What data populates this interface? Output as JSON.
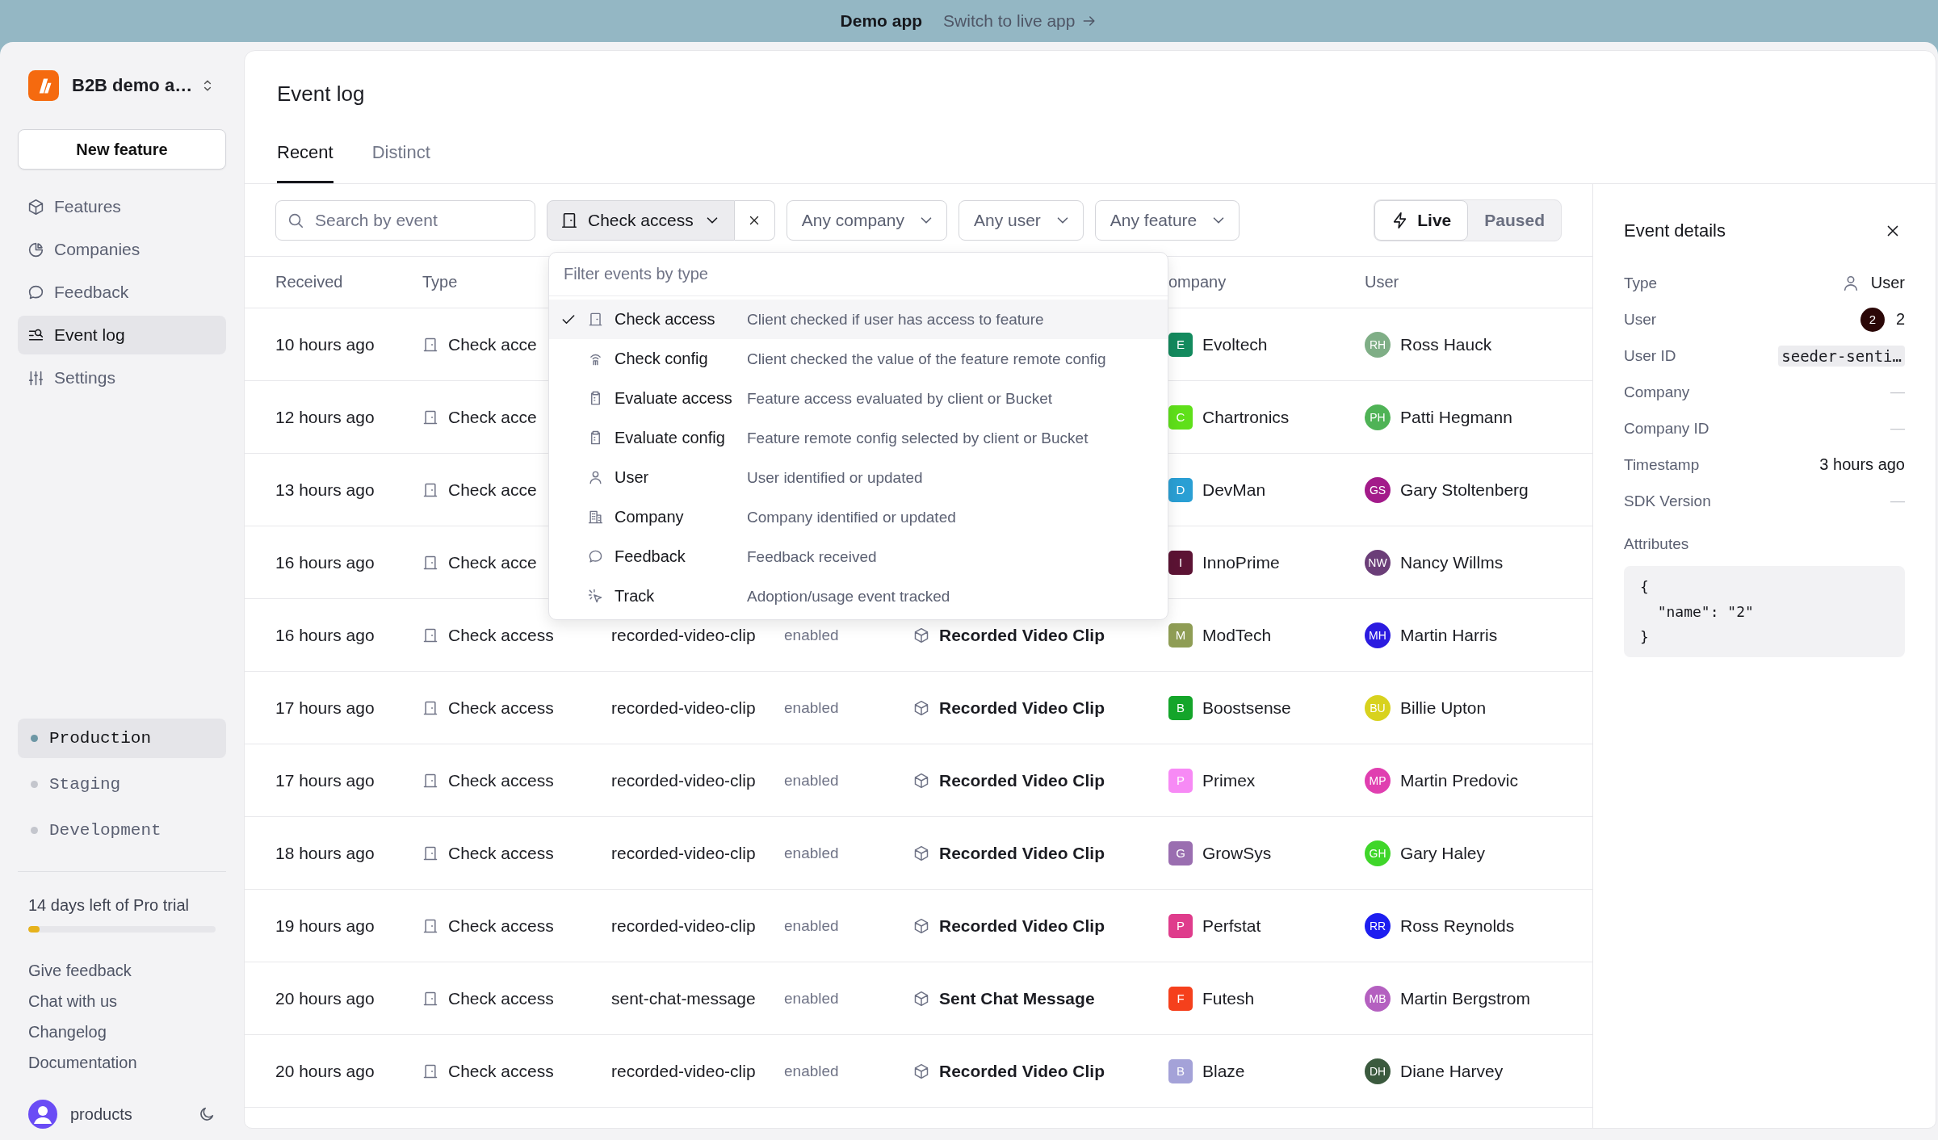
{
  "banner": {
    "label": "Demo app",
    "link": "Switch to live app"
  },
  "sidebar": {
    "workspace": "B2B demo a…",
    "new_feature": "New feature",
    "nav": [
      {
        "label": "Features",
        "kind": "features",
        "selected": false
      },
      {
        "label": "Companies",
        "kind": "companies",
        "selected": false
      },
      {
        "label": "Feedback",
        "kind": "feedback",
        "selected": false
      },
      {
        "label": "Event log",
        "kind": "events",
        "selected": true
      },
      {
        "label": "Settings",
        "kind": "settings",
        "selected": false
      }
    ],
    "environments": [
      {
        "label": "Production",
        "selected": true
      },
      {
        "label": "Staging",
        "selected": false
      },
      {
        "label": "Development",
        "selected": false
      }
    ],
    "trial": {
      "text": "14 days left of Pro trial",
      "level": 0.06
    },
    "links": [
      "Give feedback",
      "Chat with us",
      "Changelog",
      "Documentation"
    ],
    "account": {
      "name": "products"
    }
  },
  "main": {
    "title": "Event log",
    "tabs": [
      {
        "label": "Recent",
        "selected": true
      },
      {
        "label": "Distinct",
        "selected": false
      }
    ],
    "search": {
      "placeholder": "Search by event"
    },
    "type_filter": {
      "value": "Check access"
    },
    "filters": [
      "Any company",
      "Any user",
      "Any feature"
    ],
    "mode": [
      {
        "label": "Live",
        "selected": true
      },
      {
        "label": "Paused",
        "selected": false
      }
    ],
    "columns": [
      "Received",
      "Type",
      "ompany",
      "User"
    ],
    "rows": [
      {
        "received": "10 hours ago",
        "type": "Check acce",
        "company": {
          "initial": "E",
          "name": "Evoltech",
          "color": "#138a5e"
        },
        "user": {
          "initials": "RH",
          "name": "Ross Hauck",
          "color": "#7fae86"
        }
      },
      {
        "received": "12 hours ago",
        "type": "Check acce",
        "company": {
          "initial": "C",
          "name": "Chartronics",
          "color": "#5fe01a"
        },
        "user": {
          "initials": "PH",
          "name": "Patti Hegmann",
          "color": "#4fb356"
        }
      },
      {
        "received": "13 hours ago",
        "type": "Check acce",
        "company": {
          "initial": "D",
          "name": "DevMan",
          "color": "#2a9fd4"
        },
        "user": {
          "initials": "GS",
          "name": "Gary Stoltenberg",
          "color": "#a31b8a"
        }
      },
      {
        "received": "16 hours ago",
        "type": "Check acce",
        "company": {
          "initial": "I",
          "name": "InnoPrime",
          "color": "#5c1334"
        },
        "user": {
          "initials": "NW",
          "name": "Nancy Willms",
          "color": "#6b3e78"
        }
      },
      {
        "received": "16 hours ago",
        "type": "Check access",
        "key": "recorded-video-clip",
        "status": "enabled",
        "feature": "Recorded Video Clip",
        "company": {
          "initial": "M",
          "name": "ModTech",
          "color": "#8f9d55"
        },
        "user": {
          "initials": "MH",
          "name": "Martin Harris",
          "color": "#2b1be0"
        }
      },
      {
        "received": "17 hours ago",
        "type": "Check access",
        "key": "recorded-video-clip",
        "status": "enabled",
        "feature": "Recorded Video Clip",
        "company": {
          "initial": "B",
          "name": "Boostsense",
          "color": "#14a52a"
        },
        "user": {
          "initials": "BU",
          "name": "Billie Upton",
          "color": "#d8d21e"
        }
      },
      {
        "received": "17 hours ago",
        "type": "Check access",
        "key": "recorded-video-clip",
        "status": "enabled",
        "feature": "Recorded Video Clip",
        "company": {
          "initial": "P",
          "name": "Primex",
          "color": "#f78af5"
        },
        "user": {
          "initials": "MP",
          "name": "Martin Predovic",
          "color": "#e03fb0"
        }
      },
      {
        "received": "18 hours ago",
        "type": "Check access",
        "key": "recorded-video-clip",
        "status": "enabled",
        "feature": "Recorded Video Clip",
        "company": {
          "initial": "G",
          "name": "GrowSys",
          "color": "#9a6eb0"
        },
        "user": {
          "initials": "GH",
          "name": "Gary Haley",
          "color": "#3fd62a"
        }
      },
      {
        "received": "19 hours ago",
        "type": "Check access",
        "key": "recorded-video-clip",
        "status": "enabled",
        "feature": "Recorded Video Clip",
        "company": {
          "initial": "P",
          "name": "Perfstat",
          "color": "#df3c8c"
        },
        "user": {
          "initials": "RR",
          "name": "Ross Reynolds",
          "color": "#1d1ef0"
        }
      },
      {
        "received": "20 hours ago",
        "type": "Check access",
        "key": "sent-chat-message",
        "status": "enabled",
        "feature": "Sent Chat Message",
        "company": {
          "initial": "F",
          "name": "Futesh",
          "color": "#f5401c"
        },
        "user": {
          "initials": "MB",
          "name": "Martin Bergstrom",
          "color": "#b460c0"
        }
      },
      {
        "received": "20 hours ago",
        "type": "Check access",
        "key": "recorded-video-clip",
        "status": "enabled",
        "feature": "Recorded Video Clip",
        "company": {
          "initial": "B",
          "name": "Blaze",
          "color": "#a4a2d8"
        },
        "user": {
          "initials": "DH",
          "name": "Diane Harvey",
          "color": "#3b5a3e"
        }
      }
    ],
    "type_menu": {
      "placeholder": "Filter events by type",
      "options": [
        {
          "kind": "check_access",
          "label": "Check access",
          "description": "Client checked if user has access to feature",
          "selected": true
        },
        {
          "kind": "check_config",
          "label": "Check config",
          "description": "Client checked the value of the feature remote config",
          "selected": false
        },
        {
          "kind": "evaluate",
          "label": "Evaluate access",
          "description": "Feature access evaluated by client or Bucket",
          "selected": false
        },
        {
          "kind": "evaluate",
          "label": "Evaluate config",
          "description": "Feature remote config selected by client or Bucket",
          "selected": false
        },
        {
          "kind": "user",
          "label": "User",
          "description": "User identified or updated",
          "selected": false
        },
        {
          "kind": "company",
          "label": "Company",
          "description": "Company identified or updated",
          "selected": false
        },
        {
          "kind": "feedback",
          "label": "Feedback",
          "description": "Feedback received",
          "selected": false
        },
        {
          "kind": "track",
          "label": "Track",
          "description": "Adoption/usage event tracked",
          "selected": false
        }
      ]
    }
  },
  "details": {
    "title": "Event details",
    "fields": [
      {
        "label": "Type",
        "kind": "type",
        "value": "User"
      },
      {
        "label": "User",
        "kind": "avatar",
        "avatar": "2",
        "value": "2"
      },
      {
        "label": "User ID",
        "kind": "code",
        "value": "seeder-senti…"
      },
      {
        "label": "Company",
        "kind": "empty",
        "value": "—"
      },
      {
        "label": "Company ID",
        "kind": "empty",
        "value": "—"
      },
      {
        "label": "Timestamp",
        "kind": "text",
        "value": "3 hours ago"
      },
      {
        "label": "SDK Version",
        "kind": "empty",
        "value": "—"
      }
    ],
    "attributes_label": "Attributes",
    "attributes": [
      "{",
      "  \"name\": \"2\"",
      "}"
    ]
  }
}
